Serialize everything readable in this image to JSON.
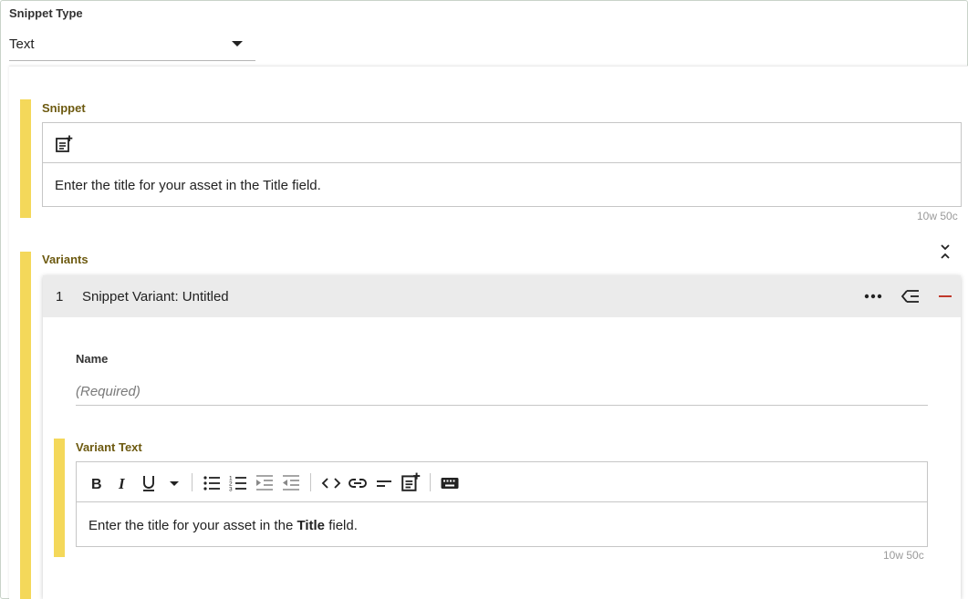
{
  "snippet_type": {
    "label": "Snippet Type",
    "value": "Text"
  },
  "snippet": {
    "label": "Snippet",
    "content": "Enter the title for your asset in the Title field.",
    "counter": "10w 50c"
  },
  "variants": {
    "label": "Variants",
    "items": [
      {
        "number": "1",
        "title": "Snippet Variant: Untitled",
        "name_label": "Name",
        "name_placeholder": "(Required)",
        "variant_text_label": "Variant Text",
        "content_before": "Enter the title for your asset in the ",
        "content_bold": "Title",
        "content_after": " field.",
        "counter": "10w 50c"
      }
    ]
  },
  "colors": {
    "accent_yellow": "#f4d85a",
    "label_brown": "#6d5a10",
    "remove_red": "#c0392b"
  },
  "icons": {
    "insert_snippet": "note-add-icon",
    "collapse": "collapse-all-icon",
    "more": "more-horizontal-icon",
    "reorder": "reorder-list-icon",
    "remove": "minus-icon"
  }
}
